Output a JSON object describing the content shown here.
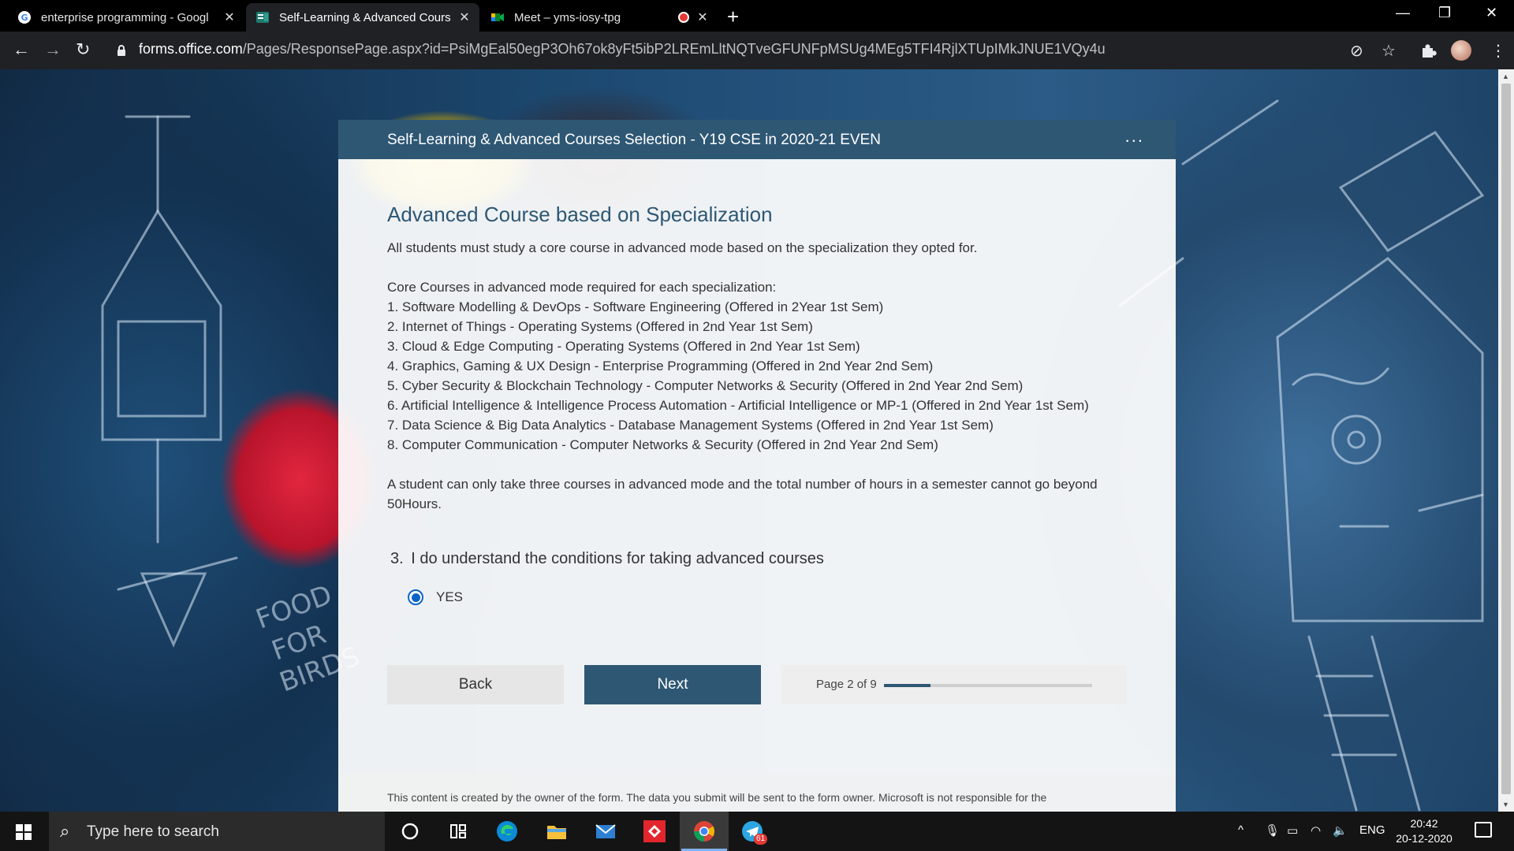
{
  "browser": {
    "tabs": [
      {
        "title": "enterprise programming - Googl",
        "active": false
      },
      {
        "title": "Self-Learning & Advanced Cours",
        "active": true
      },
      {
        "title": "Meet – yms-iosy-tpg",
        "active": false
      }
    ],
    "url_host": "forms.office.com",
    "url_path": "/Pages/ResponsePage.aspx?id=PsiMgEal50egP3Oh67ok8yFt5ibP2LREmLltNQTveGFUNFpMSUg4MEg5TFI4RjlXTUpIMkJNUE1VQy4u"
  },
  "form": {
    "header_title": "Self-Learning & Advanced Courses Selection - Y19 CSE in 2020-21 EVEN",
    "more_label": "...",
    "section_title": "Advanced Course based on Specialization",
    "intro": "All students must study a core course in advanced mode based on the specialization they opted for.",
    "list_heading": "Core Courses in advanced mode required for each specialization:",
    "list_items": [
      "1. Software Modelling & DevOps - Software Engineering (Offered in 2Year 1st Sem)",
      "2. Internet of Things - Operating Systems (Offered in 2nd Year 1st Sem)",
      "3. Cloud & Edge Computing - Operating Systems (Offered in 2nd Year 1st Sem)",
      "4. Graphics, Gaming & UX Design - Enterprise Programming (Offered in 2nd Year 2nd Sem)",
      "5. Cyber Security & Blockchain Technology - Computer Networks & Security (Offered in 2nd Year 2nd Sem)",
      "6. Artificial Intelligence & Intelligence Process Automation - Artificial Intelligence or MP-1 (Offered in 2nd Year 1st Sem)",
      "7. Data Science & Big Data Analytics - Database Management Systems (Offered in 2nd Year 1st Sem)",
      "8. Computer Communication - Computer Networks & Security (Offered in 2nd Year 2nd Sem)"
    ],
    "note": "A student can only take three courses in advanced mode and the total number of hours in a semester cannot go beyond 50Hours.",
    "question_number": "3.",
    "question_text": "I do understand the conditions for taking advanced courses",
    "option_label": "YES",
    "option_selected": true,
    "back_label": "Back",
    "next_label": "Next",
    "page_label": "Page 2 of 9",
    "progress_fraction": 0.222,
    "footer_text": "This content is created by the owner of the form. The data you submit will be sent to the form owner. Microsoft is not responsible for the"
  },
  "taskbar": {
    "search_placeholder": "Type here to search",
    "language": "ENG",
    "time": "20:42",
    "date": "20-12-2020",
    "telegram_badge": "61"
  },
  "colors": {
    "form_header": "#2e5774",
    "accent": "#0b63c5"
  }
}
